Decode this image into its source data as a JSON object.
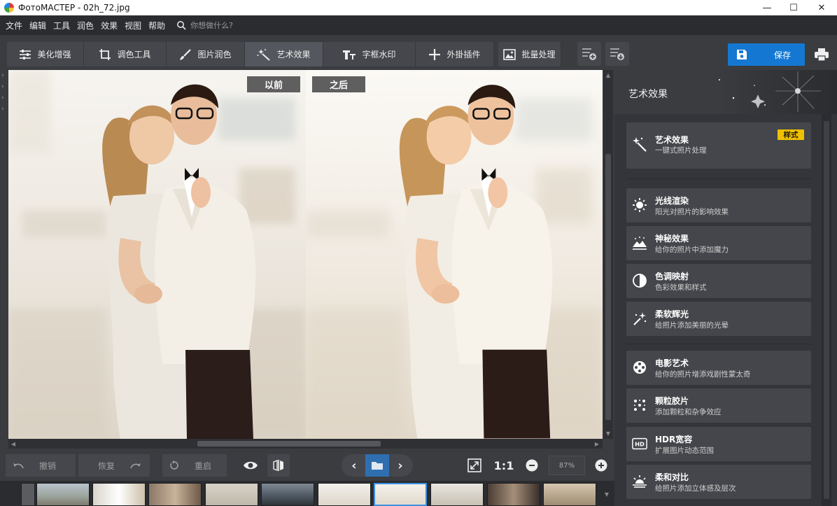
{
  "window": {
    "title": "ФотоМАСТЕР - 02h_72.jpg",
    "minimize": "—",
    "maximize": "☐",
    "close": "✕"
  },
  "menu": {
    "items": [
      "文件",
      "编辑",
      "工具",
      "润色",
      "效果",
      "视图",
      "帮助"
    ],
    "search_placeholder": "你想做什么?"
  },
  "toolbar": {
    "tabs": [
      {
        "label": "美化增强",
        "icon": "sliders-icon"
      },
      {
        "label": "调色工具",
        "icon": "crop-icon"
      },
      {
        "label": "图片润色",
        "icon": "brush-icon"
      },
      {
        "label": "艺术效果",
        "icon": "magic-wand-icon",
        "active": true
      },
      {
        "label": "字框水印",
        "icon": "text-icon"
      },
      {
        "label": "外掛插件",
        "icon": "plus-icon"
      }
    ],
    "batch_label": "批量处理",
    "save_label": "保存"
  },
  "canvas": {
    "before_label": "以前",
    "after_label": "之后"
  },
  "bottom": {
    "undo_label": "撤销",
    "redo_label": "恢复",
    "reset_label": "重启",
    "one_to_one": "1:1",
    "zoom_value": "87%"
  },
  "panel": {
    "title": "艺术效果",
    "style_badge": "样式",
    "effects": [
      {
        "title": "艺术效果",
        "desc": "一键式照片处理",
        "icon": "magic-wand-icon"
      },
      {
        "title": "光线渲染",
        "desc": "阳光对照片的影响效果",
        "icon": "sun-icon"
      },
      {
        "title": "神秘效果",
        "desc": "给你的照片中添加魔力",
        "icon": "landscape-icon"
      },
      {
        "title": "色调映射",
        "desc": "色彩效果和样式",
        "icon": "half-circle-icon"
      },
      {
        "title": "柔软辉光",
        "desc": "给照片添加美丽的光晕",
        "icon": "sparkle-icon"
      },
      {
        "title": "电影艺术",
        "desc": "给你的照片增添戏剧性蒙太奇",
        "icon": "film-reel-icon"
      },
      {
        "title": "颗粒胶片",
        "desc": "添加颗粒和杂争效应",
        "icon": "grain-icon"
      },
      {
        "title": "HDR宽容",
        "desc": "扩展图片动态范围",
        "icon": "hdr-icon"
      },
      {
        "title": "柔和对比",
        "desc": "给照片添加立体感及层次",
        "icon": "sunrise-icon"
      }
    ]
  },
  "colors": {
    "accent": "#1478d2",
    "badge": "#f0c000",
    "panel_bg": "#33353a",
    "card_bg": "#44464b"
  }
}
